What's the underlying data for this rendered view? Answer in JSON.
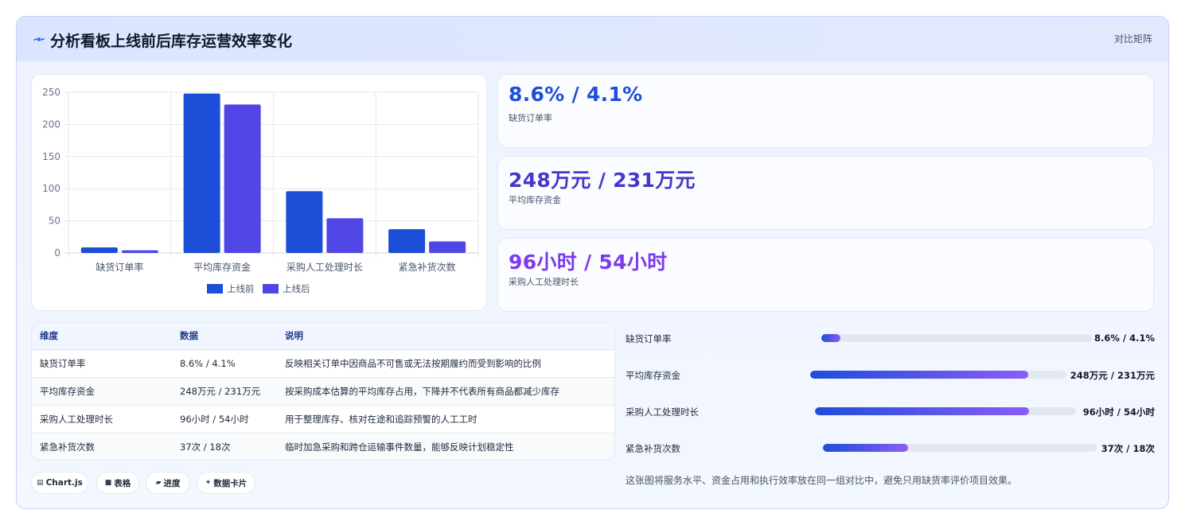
{
  "header": {
    "title": "分析看板上线前后库存运营效率变化",
    "tag": "对比矩阵"
  },
  "colors": {
    "before": "#1d4ed8",
    "after": "#4f46e5",
    "grad_start": "#1d4ed8",
    "grad_end": "#8b5cf6"
  },
  "chart_data": {
    "type": "bar",
    "categories": [
      "缺货订单率",
      "平均库存资金",
      "采购人工处理时长",
      "紧急补货次数"
    ],
    "series": [
      {
        "name": "上线前",
        "values": [
          8.6,
          248,
          96,
          37
        ]
      },
      {
        "name": "上线后",
        "values": [
          4.1,
          231,
          54,
          18
        ]
      }
    ],
    "ylim": [
      0,
      250
    ],
    "yticks": [
      0,
      50,
      100,
      150,
      200,
      250
    ],
    "grid": true,
    "legend": "bottom"
  },
  "stats": [
    {
      "value": "8.6% / 4.1%",
      "label": "缺货订单率",
      "color": "#1d4ed8"
    },
    {
      "value": "248万元 / 231万元",
      "label": "平均库存资金",
      "color": "#4338ca"
    },
    {
      "value": "96小时 / 54小时",
      "label": "采购人工处理时长",
      "color": "#7c3aed"
    }
  ],
  "table": {
    "headers": [
      "维度",
      "数据",
      "说明"
    ],
    "rows": [
      [
        "缺货订单率",
        "8.6% / 4.1%",
        "反映相关订单中因商品不可售或无法按期履约而受到影响的比例"
      ],
      [
        "平均库存资金",
        "248万元 / 231万元",
        "按采购成本估算的平均库存占用，下降并不代表所有商品都减少库存"
      ],
      [
        "采购人工处理时长",
        "96小时 / 54小时",
        "用于整理库存、核对在途和追踪预警的人工工时"
      ],
      [
        "紧急补货次数",
        "37次 / 18次",
        "临时加急采购和跨仓运输事件数量，能够反映计划稳定性"
      ]
    ]
  },
  "chips": [
    {
      "icon": "▤",
      "label": "Chart.js"
    },
    {
      "icon": "■",
      "label": "表格"
    },
    {
      "icon": "▰",
      "label": "进度"
    },
    {
      "icon": "✦",
      "label": "数据卡片"
    }
  ],
  "progress": [
    {
      "label": "缺货订单率",
      "value": "8.6% / 4.1%",
      "fraction": 0.07
    },
    {
      "label": "平均库存资金",
      "value": "248万元 / 231万元",
      "fraction": 0.85
    },
    {
      "label": "采购人工处理时长",
      "value": "96小时 / 54小时",
      "fraction": 0.82
    },
    {
      "label": "紧急补货次数",
      "value": "37次 / 18次",
      "fraction": 0.31
    }
  ],
  "note": "这张图将服务水平、资金占用和执行效率放在同一组对比中，避免只用缺货率评价项目效果。"
}
